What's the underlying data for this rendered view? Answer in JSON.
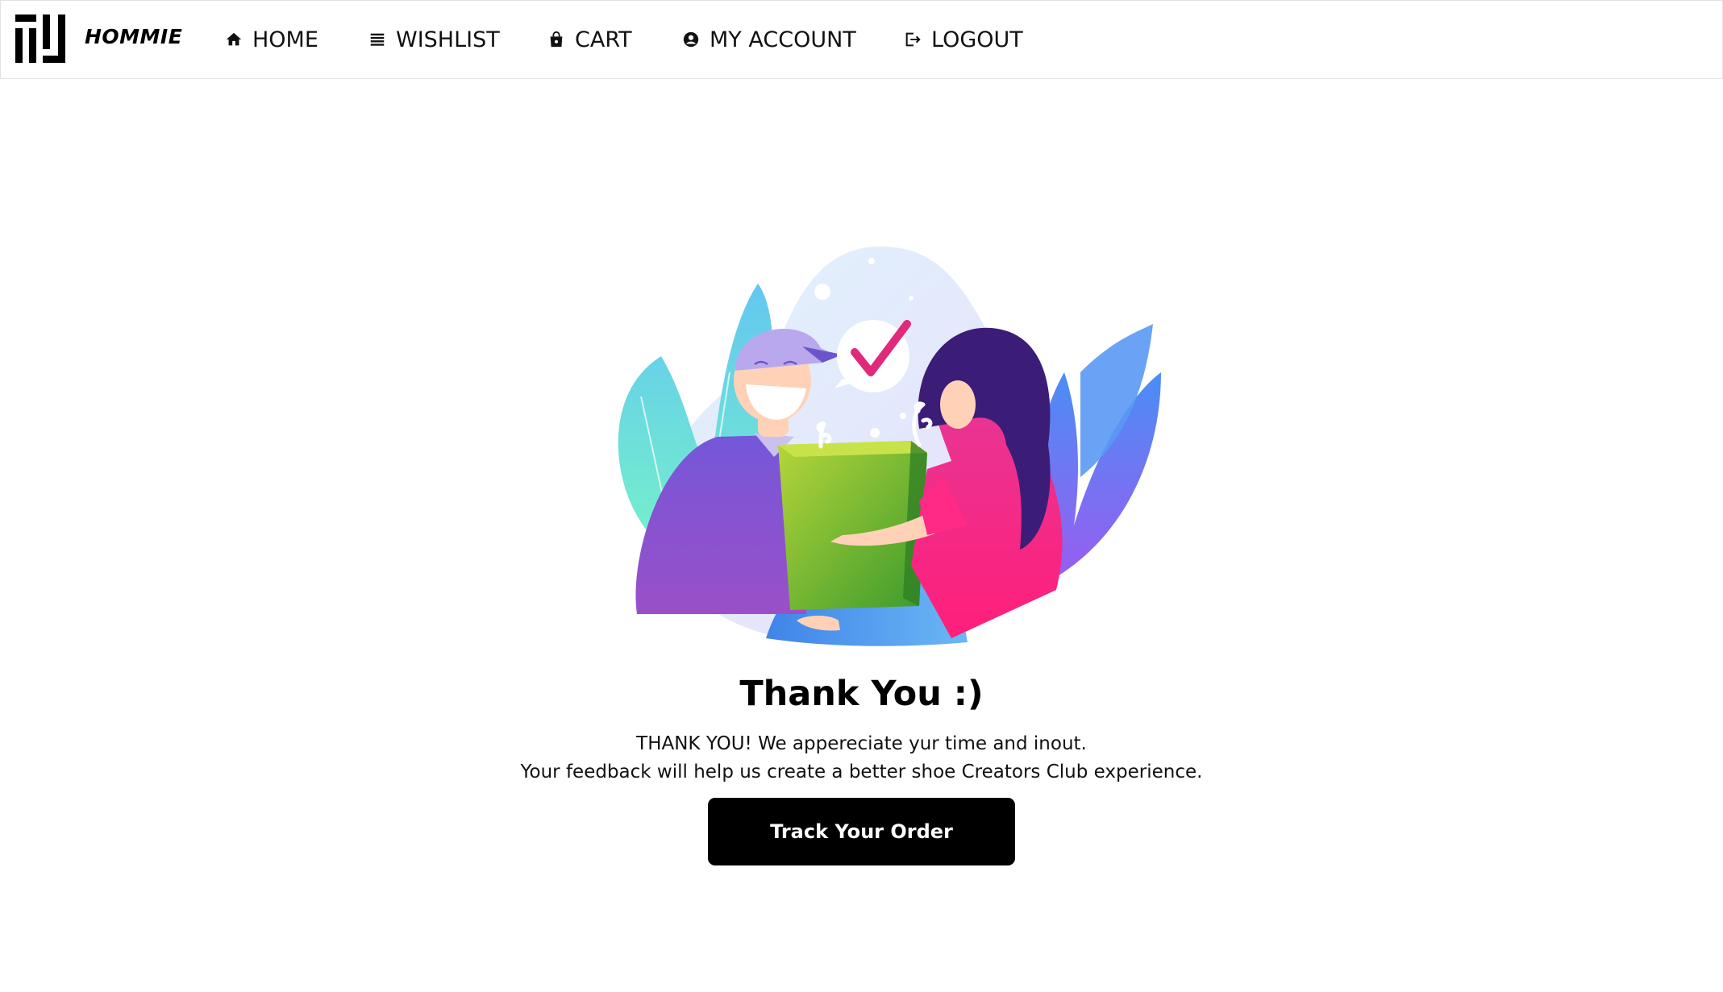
{
  "brand": {
    "name": "HOMMIE",
    "logo_icon": "hommie-logo-icon"
  },
  "nav": {
    "items": [
      {
        "label": "HOME",
        "icon": "home-icon"
      },
      {
        "label": "WISHLIST",
        "icon": "list-icon"
      },
      {
        "label": "CART",
        "icon": "shopping-bag-icon"
      },
      {
        "label": "MY ACCOUNT",
        "icon": "user-circle-icon"
      },
      {
        "label": "LOGOUT",
        "icon": "logout-icon"
      }
    ]
  },
  "main": {
    "illustration": "delivery-handover-illustration",
    "title": "Thank You :)",
    "message_line1": "THANK YOU! We appereciate yur time and inout.",
    "message_line2": "Your feedback will help us create a better shoe Creators Club experience.",
    "button_label": "Track Your Order"
  },
  "colors": {
    "button_bg": "#000000",
    "button_text": "#ffffff",
    "checkmark": "#e0297a",
    "nav_border": "#e2e2e2"
  }
}
